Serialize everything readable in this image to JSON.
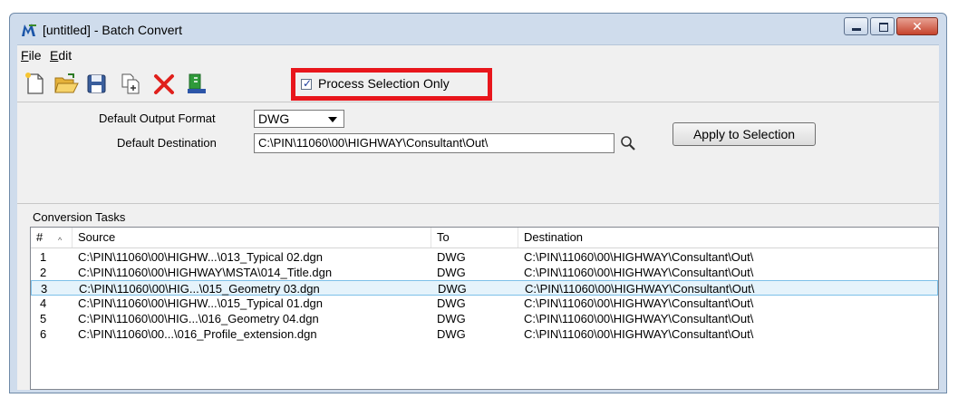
{
  "window": {
    "title": "[untitled] - Batch Convert",
    "icon": "microstation-icon"
  },
  "titlebar_buttons": {
    "close_glyph": "✕"
  },
  "menu": [
    {
      "label": "File",
      "underline": "F"
    },
    {
      "label": "Edit",
      "underline": "E"
    }
  ],
  "toolbar": {
    "icons": [
      "new-file-icon",
      "open-folder-icon",
      "save-icon",
      "add-files-icon",
      "delete-icon",
      "process-icon"
    ],
    "process_selection_only": {
      "label": "Process Selection Only",
      "checked": true
    }
  },
  "settings": {
    "output_format_label": "Default Output Format",
    "output_format_value": "DWG",
    "destination_label": "Default Destination",
    "destination_value": "C:\\PIN\\11060\\00\\HIGHWAY\\Consultant\\Out\\",
    "apply_button": "Apply to Selection"
  },
  "tasks": {
    "label": "Conversion Tasks",
    "columns": [
      "#",
      "Source",
      "To",
      "Destination"
    ],
    "rows": [
      {
        "num": "1",
        "source": "C:\\PIN\\11060\\00\\HIGHW...\\013_Typical 02.dgn",
        "to": "DWG",
        "dest": "C:\\PIN\\11060\\00\\HIGHWAY\\Consultant\\Out\\"
      },
      {
        "num": "2",
        "source": "C:\\PIN\\11060\\00\\HIGHWAY\\MSTA\\014_Title.dgn",
        "to": "DWG",
        "dest": "C:\\PIN\\11060\\00\\HIGHWAY\\Consultant\\Out\\"
      },
      {
        "num": "3",
        "source": "C:\\PIN\\11060\\00\\HIG...\\015_Geometry 03.dgn",
        "to": "DWG",
        "dest": "C:\\PIN\\11060\\00\\HIGHWAY\\Consultant\\Out\\"
      },
      {
        "num": "4",
        "source": "C:\\PIN\\11060\\00\\HIGHW...\\015_Typical 01.dgn",
        "to": "DWG",
        "dest": "C:\\PIN\\11060\\00\\HIGHWAY\\Consultant\\Out\\"
      },
      {
        "num": "5",
        "source": "C:\\PIN\\11060\\00\\HIG...\\016_Geometry 04.dgn",
        "to": "DWG",
        "dest": "C:\\PIN\\11060\\00\\HIGHWAY\\Consultant\\Out\\"
      },
      {
        "num": "6",
        "source": "C:\\PIN\\11060\\00...\\016_Profile_extension.dgn",
        "to": "DWG",
        "dest": "C:\\PIN\\11060\\00\\HIGHWAY\\Consultant\\Out\\"
      }
    ],
    "selected_row": 3
  },
  "colors": {
    "highlight": "#e8161c",
    "selection": "#e5f3fb",
    "delete": "#e0201c"
  }
}
